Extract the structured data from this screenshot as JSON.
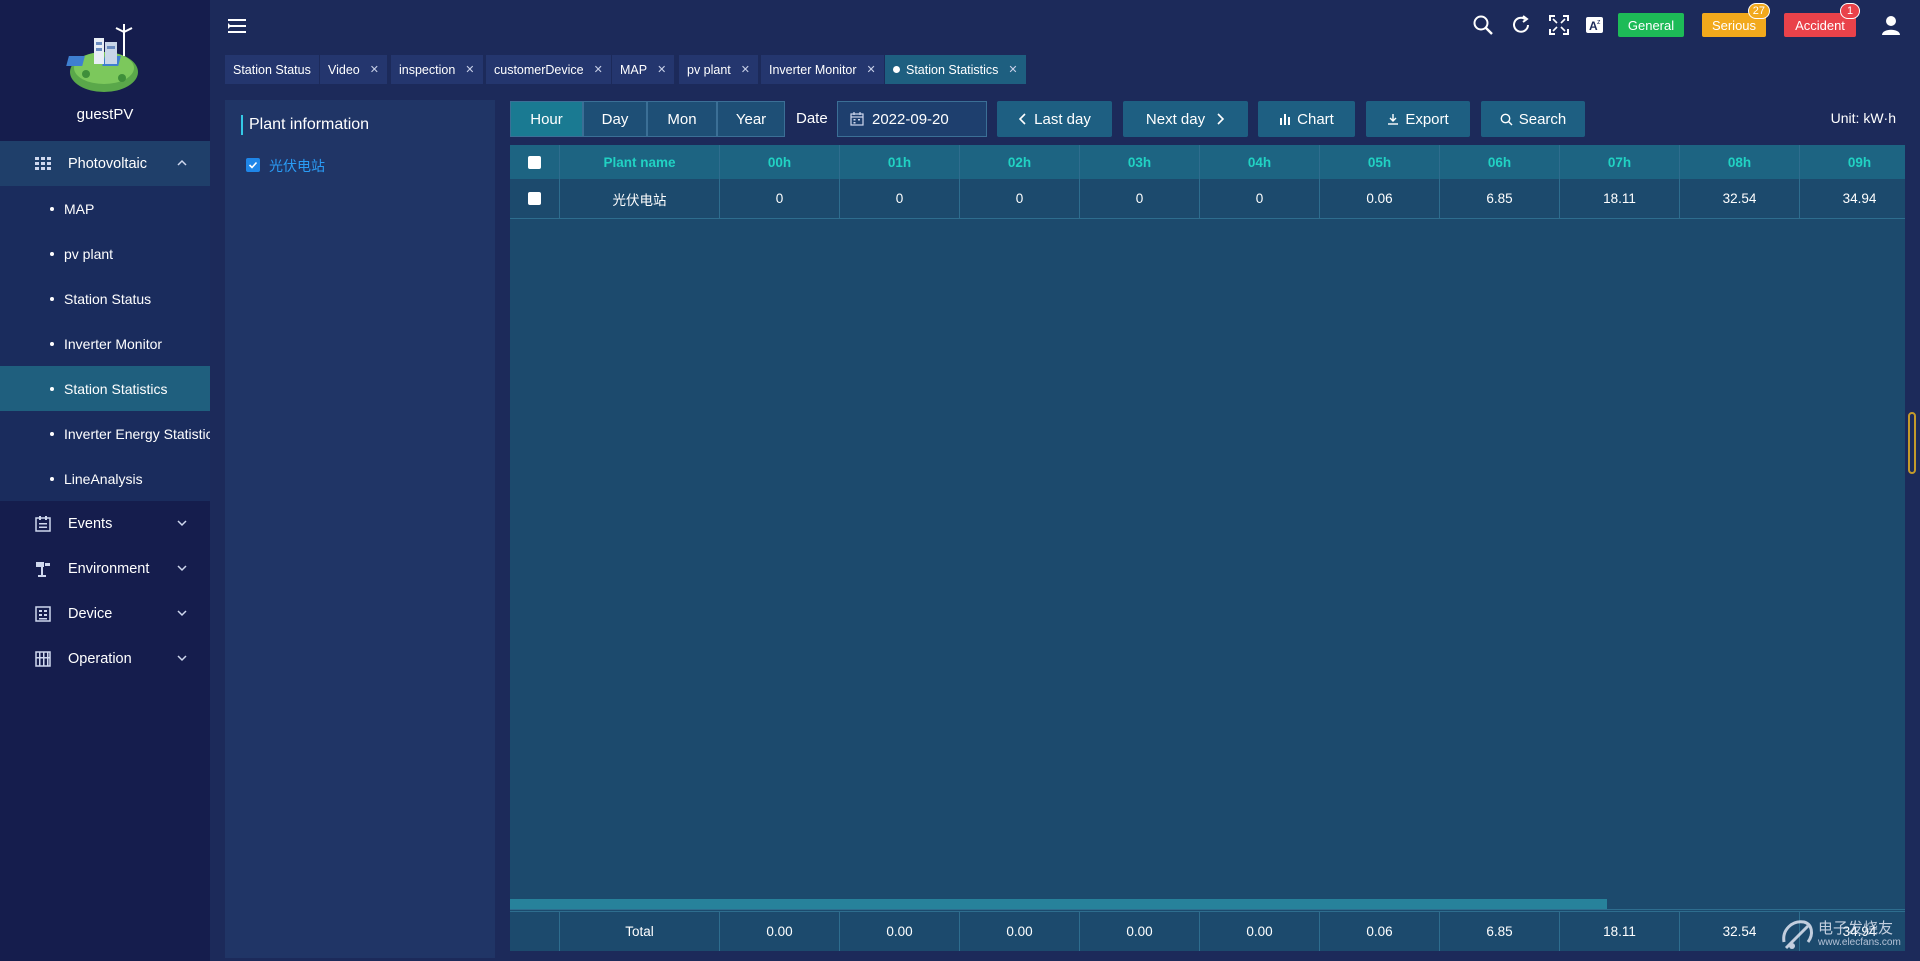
{
  "user": {
    "name": "guestPV"
  },
  "sidebar": {
    "groups": {
      "photovoltaic": {
        "label": "Photovoltaic",
        "icon": "grid-panel-icon"
      },
      "events": {
        "label": "Events",
        "icon": "events-icon"
      },
      "environment": {
        "label": "Environment",
        "icon": "weather-station-icon"
      },
      "device": {
        "label": "Device",
        "icon": "device-icon"
      },
      "operation": {
        "label": "Operation",
        "icon": "operation-icon"
      }
    },
    "pv_items": [
      "MAP",
      "pv plant",
      "Station Status",
      "Inverter Monitor",
      "Station Statistics",
      "Inverter Energy Statistics",
      "LineAnalysis"
    ],
    "active_item": "Station Statistics"
  },
  "header": {
    "alarms": {
      "general": {
        "label": "General",
        "color": "#1dbb57"
      },
      "serious": {
        "label": "Serious",
        "count": "27",
        "color": "#f2a91c"
      },
      "accident": {
        "label": "Accident",
        "count": "1",
        "color": "#e9424a"
      }
    }
  },
  "tabs": [
    "Station Status",
    "Video",
    "inspection",
    "customerDevice",
    "MAP",
    "pv plant",
    "Inverter Monitor",
    "Station Statistics"
  ],
  "panel": {
    "title": "Plant information",
    "plant": "光伏电站"
  },
  "toolbar": {
    "granularity": [
      "Hour",
      "Day",
      "Mon",
      "Year"
    ],
    "active_granularity": "Hour",
    "date_label": "Date",
    "date_value": "2022-09-20",
    "last_day": "Last day",
    "next_day": "Next day",
    "chart": "Chart",
    "export": "Export",
    "search": "Search",
    "unit": "Unit:  kW·h"
  },
  "table": {
    "name_header": "Plant name",
    "hour_headers": [
      "00h",
      "01h",
      "02h",
      "03h",
      "04h",
      "05h",
      "06h",
      "07h",
      "08h",
      "09h"
    ],
    "rows": [
      {
        "name": "光伏电站",
        "values": [
          "0",
          "0",
          "0",
          "0",
          "0",
          "0.06",
          "6.85",
          "18.11",
          "32.54",
          "34.94"
        ]
      }
    ],
    "total_label": "Total",
    "totals": [
      "0.00",
      "0.00",
      "0.00",
      "0.00",
      "0.00",
      "0.06",
      "6.85",
      "18.11",
      "32.54",
      "34.94"
    ]
  },
  "watermark": {
    "text": "电子发烧友",
    "url": "www.elecfans.com"
  }
}
